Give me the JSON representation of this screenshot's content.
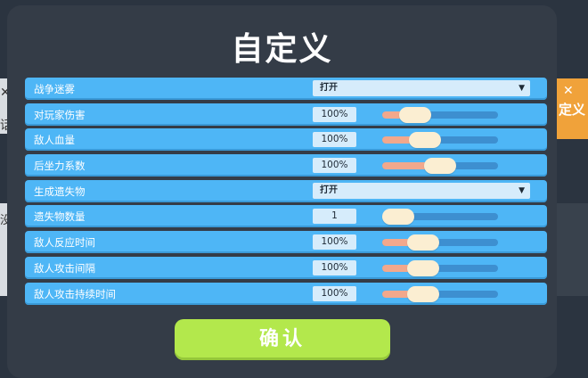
{
  "title": "自定义",
  "background": {
    "right_tab_text": "定义",
    "left_tab_text": "话",
    "left_tab2_text": "没"
  },
  "rows": [
    {
      "label": "战争迷雾",
      "type": "dropdown",
      "value": "打开"
    },
    {
      "label": "对玩家伤害",
      "type": "slider",
      "value": "100%",
      "level": 0.2
    },
    {
      "label": "敌人血量",
      "type": "slider",
      "value": "100%",
      "level": 0.32
    },
    {
      "label": "后坐力系数",
      "type": "slider",
      "value": "100%",
      "level": 0.5
    },
    {
      "label": "生成遗失物",
      "type": "dropdown",
      "value": "打开"
    },
    {
      "label": "遗失物数量",
      "type": "slider",
      "value": "1",
      "level": 0.0
    },
    {
      "label": "敌人反应时间",
      "type": "slider",
      "value": "100%",
      "level": 0.3
    },
    {
      "label": "敌人攻击间隔",
      "type": "slider",
      "value": "100%",
      "level": 0.3
    },
    {
      "label": "敌人攻击持续时间",
      "type": "slider",
      "value": "100%",
      "level": 0.3
    }
  ],
  "confirm_label": "确认",
  "colors": {
    "row": "#4eb6f6",
    "confirm": "#b3e84c",
    "fill": "#f2a88c",
    "knob": "#fbeed2"
  }
}
